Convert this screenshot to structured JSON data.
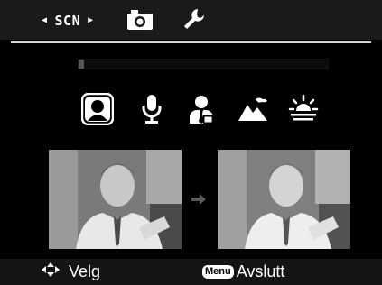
{
  "header": {
    "active_tab_label": "SCN",
    "tabs": [
      {
        "name": "scene-mode",
        "label": "SCN",
        "icon": "chevrons-left-right-icon"
      },
      {
        "name": "camera",
        "icon": "camera-icon"
      },
      {
        "name": "setup",
        "icon": "wrench-icon"
      }
    ]
  },
  "progress": {
    "value": 0.02
  },
  "scenes": [
    {
      "id": "portrait",
      "icon": "portrait-icon",
      "selected": true
    },
    {
      "id": "voice",
      "icon": "microphone-icon",
      "selected": false
    },
    {
      "id": "business-person",
      "icon": "person-tie-icon",
      "selected": false
    },
    {
      "id": "landscape",
      "icon": "mountain-icon",
      "selected": false
    },
    {
      "id": "sunset",
      "icon": "sunset-icon",
      "selected": false
    }
  ],
  "preview": {
    "before_icon": "portrait-photo",
    "after_icon": "portrait-photo-softened",
    "arrow_icon": "arrow-right-icon"
  },
  "footer": {
    "select_label": "Velg",
    "menu_badge": "Menu",
    "exit_label": "Avslutt"
  },
  "colors": {
    "bar_bg": "#1a1a1a",
    "divider": "#d8d8d8",
    "icon": "#ffffff"
  }
}
